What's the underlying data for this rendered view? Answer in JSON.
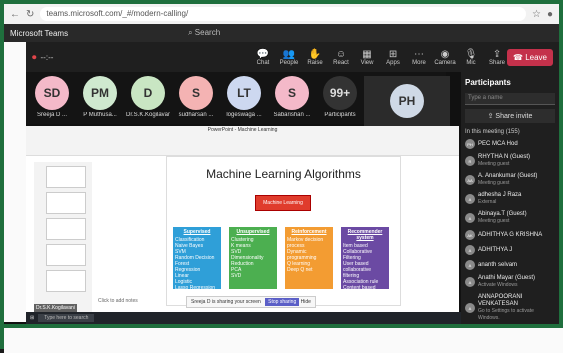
{
  "browser": {
    "url": "teams.microsoft.com/_#/modern-calling/"
  },
  "teams": {
    "app_name": "Microsoft Teams",
    "search_placeholder": "Search"
  },
  "call": {
    "timer": "--:--",
    "controls": [
      {
        "icon": "chat-icon",
        "label": "Chat"
      },
      {
        "icon": "people-icon",
        "label": "People"
      },
      {
        "icon": "raise-hand-icon",
        "label": "Raise"
      },
      {
        "icon": "react-icon",
        "label": "React"
      },
      {
        "icon": "view-icon",
        "label": "View"
      },
      {
        "icon": "apps-icon",
        "label": "Apps"
      },
      {
        "icon": "more-icon",
        "label": "More"
      },
      {
        "icon": "camera-icon",
        "label": "Camera"
      },
      {
        "icon": "mic-icon",
        "label": "Mic"
      },
      {
        "icon": "share-icon",
        "label": "Share"
      }
    ],
    "leave_label": "Leave"
  },
  "participants_row": [
    {
      "initials": "SD",
      "name": "Sreeja D ...",
      "color": "#f4b9c9"
    },
    {
      "initials": "PM",
      "name": "P Muthusa...",
      "color": "#cfe9cf"
    },
    {
      "initials": "D",
      "name": "Dr.S.K.Kogilavani",
      "color": "#c9e6c3"
    },
    {
      "initials": "S",
      "name": "sudharsan ...",
      "color": "#f4b3b3"
    },
    {
      "initials": "LT",
      "name": "logeswaga ...",
      "color": "#cdd8f0"
    },
    {
      "initials": "S",
      "name": "Sabarishan ...",
      "color": "#f4b9c9"
    },
    {
      "initials": "99+",
      "name": "Participants",
      "color": "#333333"
    }
  ],
  "ph_tile": {
    "initials": "PH"
  },
  "panel": {
    "title": "Participants",
    "input_placeholder": "Type a name",
    "share_invite": "Share invite",
    "in_meeting": "In this meeting (155)",
    "people": [
      {
        "initials": "PH",
        "name": "PEC MCA Hod",
        "sub": ""
      },
      {
        "initials": "R",
        "name": "RHYTHA N (Guest)",
        "sub": "Meeting guest"
      },
      {
        "initials": "AA",
        "name": "A. Anankumar (Guest)",
        "sub": "Meeting guest"
      },
      {
        "initials": "A",
        "name": "adhesha J Raza",
        "sub": "External"
      },
      {
        "initials": "A",
        "name": "Abinaya.T (Guest)",
        "sub": "Meeting guest"
      },
      {
        "initials": "AK",
        "name": "ADHITHYA G KRISHNA",
        "sub": ""
      },
      {
        "initials": "A",
        "name": "ADHITHYA J",
        "sub": ""
      },
      {
        "initials": "A",
        "name": "ananth selvam",
        "sub": ""
      },
      {
        "initials": "A",
        "name": "Anathi Mayar (Guest)",
        "sub": "Activate Windows"
      },
      {
        "initials": "A",
        "name": "ANNAPOORANI VENKATESAN",
        "sub": "Go to Settings to activate Windows."
      }
    ]
  },
  "ppt": {
    "window_title": "PowerPoint - Machine Learning",
    "slide_title": "Machine Learning Algorithms",
    "center_box": "Machine Learning",
    "notes": "Click to add notes",
    "sharing_text": "Sreeja D is sharing your screen",
    "stop_sharing": "Stop sharing",
    "hide": "Hide",
    "categories": [
      {
        "title": "Supervised",
        "color": "#2f9fd8",
        "items": [
          "Classification",
          "Naive Bayes",
          "SVM",
          "Random Decision Forest",
          "Regression",
          "Linear",
          "Logistic",
          "Lasso Regression"
        ]
      },
      {
        "title": "Unsupervised",
        "color": "#4caf50",
        "items": [
          "Clustering",
          "K means",
          "SVD",
          "Dimensionality Reduction",
          "PCA",
          "SVD"
        ]
      },
      {
        "title": "Reinforcement",
        "color": "#f39c32",
        "items": [
          "Markov decision process",
          "Dynamic programming",
          "Q learning",
          "Deep Q net"
        ]
      },
      {
        "title": "Recommender system",
        "color": "#6b4aa3",
        "items": [
          "Item based",
          "Collaborative Filtering",
          "User based collaborative",
          "filtering",
          "Association rule",
          "Content based"
        ]
      }
    ]
  },
  "taskbar": {
    "search": "Type here to search"
  },
  "self_label": "Dr.S.K.Kogilavani"
}
